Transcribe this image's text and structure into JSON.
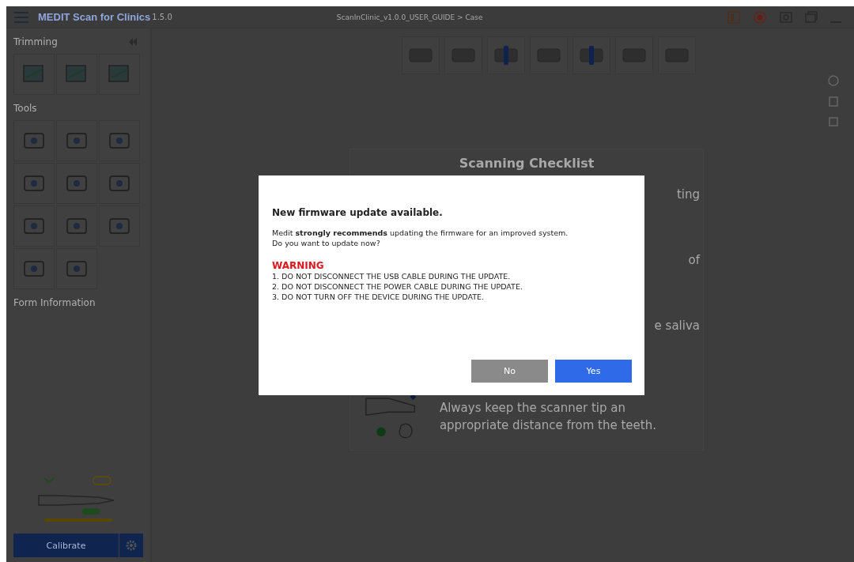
{
  "title_bar": {
    "app_name": "MEDIT Scan for Clinics",
    "version": "1.5.0",
    "document": "ScanInClinic_v1.0.0_USER_GUIDE > Case"
  },
  "sidebar": {
    "trimming_title": "Trimming",
    "tools_title": "Tools",
    "form_title": "Form Information",
    "calibrate_button": "Calibrate"
  },
  "checklist": {
    "title": "Scanning Checklist",
    "items": [
      {
        "kind": "partial",
        "text": "ting"
      },
      {
        "kind": "partial",
        "text": "of"
      },
      {
        "kind": "partial",
        "text": "e saliva"
      },
      {
        "kind": "full",
        "text": "Always keep the scanner tip an appropriate distance from the teeth."
      }
    ]
  },
  "dialog": {
    "title": "New firmware update available.",
    "message": "Medit **strongly recommends** updating the firmware for an improved system.",
    "question": "Do you want to update now?",
    "warning_title": "WARNING",
    "warnings": [
      "1. DO NOT DISCONNECT THE USB CABLE DURING THE UPDATE.",
      "2. DO NOT DISCONNECT THE POWER CABLE DURING THE UPDATE.",
      "3. DO NOT TURN OFF THE DEVICE DURING THE UPDATE."
    ],
    "buttons": [
      {
        "label": "No",
        "kind": "secondary"
      },
      {
        "label": "Yes",
        "kind": "primary"
      }
    ]
  }
}
